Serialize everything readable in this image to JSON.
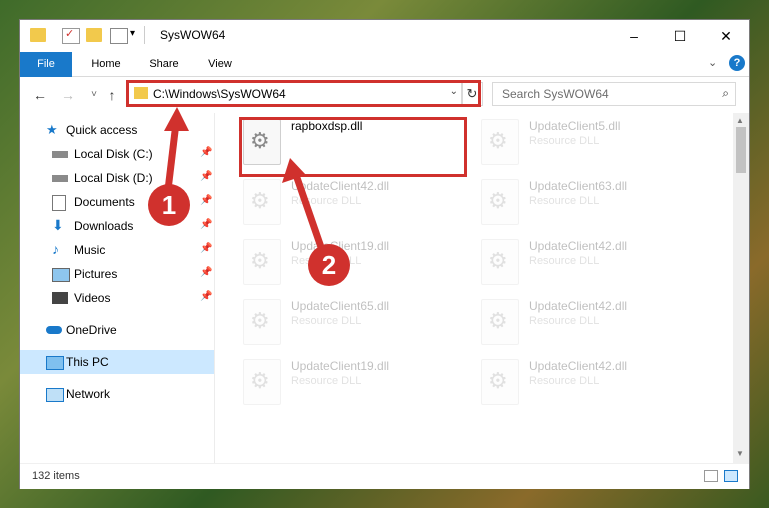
{
  "window": {
    "title": "SysWOW64",
    "controls": {
      "minimize": "–",
      "maximize": "☐",
      "close": "✕"
    }
  },
  "ribbon": {
    "tabs": [
      {
        "label": "File"
      },
      {
        "label": "Home"
      },
      {
        "label": "Share"
      },
      {
        "label": "View"
      }
    ],
    "expand_icon": "chevron-down-icon",
    "help": "?"
  },
  "navigation": {
    "back": "←",
    "forward": "→",
    "recent": "˅",
    "up": "↑",
    "address": "C:\\Windows\\SysWOW64",
    "refresh": "↻",
    "search_placeholder": "Search SysWOW64",
    "search_icon": "⌕"
  },
  "sidebar": {
    "items": [
      {
        "label": "Quick access",
        "icon": "star-icon"
      },
      {
        "label": "Local Disk (C:)",
        "icon": "drive-icon",
        "pinned": true
      },
      {
        "label": "Local Disk (D:)",
        "icon": "drive-icon",
        "pinned": true
      },
      {
        "label": "Documents",
        "icon": "documents-icon",
        "pinned": true
      },
      {
        "label": "Downloads",
        "icon": "downloads-icon",
        "pinned": true
      },
      {
        "label": "Music",
        "icon": "music-icon",
        "pinned": true
      },
      {
        "label": "Pictures",
        "icon": "pictures-icon",
        "pinned": true
      },
      {
        "label": "Videos",
        "icon": "videos-icon",
        "pinned": true
      },
      {
        "label": "OneDrive",
        "icon": "cloud-icon"
      },
      {
        "label": "This PC",
        "icon": "computer-icon",
        "selected": true
      },
      {
        "label": "Network",
        "icon": "network-icon"
      }
    ]
  },
  "files": [
    {
      "name": "rapboxdsp.dll",
      "type": ""
    },
    {
      "name": "UpdateClient5.dll",
      "type": "Resource DLL"
    },
    {
      "name": "UpdateClient42.dll",
      "type": "Resource DLL"
    },
    {
      "name": "UpdateClient63.dll",
      "type": "Resource DLL"
    },
    {
      "name": "UpdateClient19.dll",
      "type": "Resource DLL"
    },
    {
      "name": "UpdateClient42.dll",
      "type": "Resource DLL"
    },
    {
      "name": "UpdateClient65.dll",
      "type": "Resource DLL"
    },
    {
      "name": "UpdateClient42.dll",
      "type": "Resource DLL"
    },
    {
      "name": "UpdateClient19.dll",
      "type": "Resource DLL"
    },
    {
      "name": "UpdateClient42.dll",
      "type": "Resource DLL"
    }
  ],
  "status": {
    "item_count": "132 items"
  },
  "annotations": {
    "step1": "1",
    "step2": "2",
    "color": "#d0312d"
  },
  "colors": {
    "accent": "#1979ca",
    "selection": "#cce8ff",
    "folder": "#f2c94c"
  }
}
